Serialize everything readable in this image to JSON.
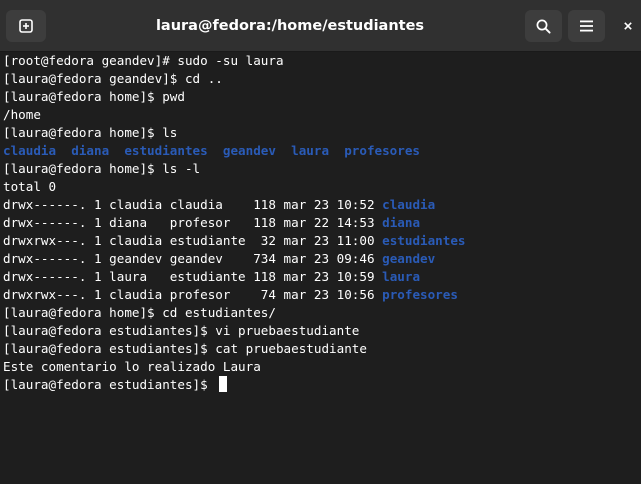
{
  "window": {
    "title": "laura@fedora:/home/estudiantes"
  },
  "icons": {
    "new_tab": "new-tab-icon",
    "search": "search-icon",
    "menu": "hamburger-menu-icon",
    "close": "close-icon"
  },
  "colors": {
    "background": "#1e1e1e",
    "titlebar": "#303030",
    "text": "#ffffff",
    "directory": "#2a5bb7"
  },
  "terminal": {
    "lines": [
      {
        "text": "[root@fedora geandev]# sudo -su laura"
      },
      {
        "text": "[laura@fedora geandev]$ cd .."
      },
      {
        "text": "[laura@fedora home]$ pwd"
      },
      {
        "text": "/home"
      },
      {
        "text": "[laura@fedora home]$ ls"
      },
      {
        "text": "",
        "dirs": "claudia  diana  estudiantes  geandev  laura  profesores"
      },
      {
        "text": "[laura@fedora home]$ ls -l"
      },
      {
        "text": "total 0"
      },
      {
        "text": "drwx------. 1 claudia claudia    118 mar 23 10:52 ",
        "dirs": "claudia"
      },
      {
        "text": "drwx------. 1 diana   profesor   118 mar 22 14:53 ",
        "dirs": "diana"
      },
      {
        "text": "drwxrwx---. 1 claudia estudiante  32 mar 23 11:00 ",
        "dirs": "estudiantes"
      },
      {
        "text": "drwx------. 1 geandev geandev    734 mar 23 09:46 ",
        "dirs": "geandev"
      },
      {
        "text": "drwx------. 1 laura   estudiante 118 mar 23 10:59 ",
        "dirs": "laura"
      },
      {
        "text": "drwxrwx---. 1 claudia profesor    74 mar 23 10:56 ",
        "dirs": "profesores"
      },
      {
        "text": "[laura@fedora home]$ cd estudiantes/"
      },
      {
        "text": "[laura@fedora estudiantes]$ vi pruebaestudiante"
      },
      {
        "text": "[laura@fedora estudiantes]$ cat pruebaestudiante"
      },
      {
        "text": "Este comentario lo realizado Laura"
      },
      {
        "text": "[laura@fedora estudiantes]$ ",
        "cursor": true
      }
    ]
  }
}
